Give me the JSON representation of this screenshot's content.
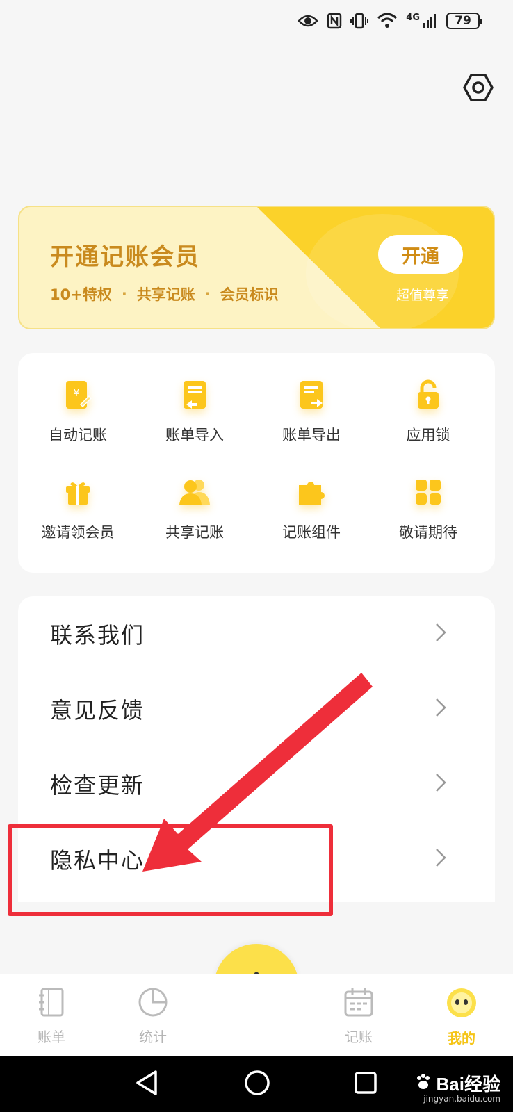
{
  "status_bar": {
    "battery": "79",
    "network": "4G"
  },
  "vip": {
    "title": "开通记账会员",
    "perks": [
      "10+特权",
      "共享记账",
      "会员标识"
    ],
    "separator": "·",
    "open_label": "开通",
    "sub_label": "超值尊享"
  },
  "tools": [
    {
      "label": "自动记账",
      "icon": "auto-bill-icon"
    },
    {
      "label": "账单导入",
      "icon": "import-icon"
    },
    {
      "label": "账单导出",
      "icon": "export-icon"
    },
    {
      "label": "应用锁",
      "icon": "lock-icon"
    },
    {
      "label": "邀请领会员",
      "icon": "gift-icon"
    },
    {
      "label": "共享记账",
      "icon": "users-icon"
    },
    {
      "label": "记账组件",
      "icon": "puzzle-icon"
    },
    {
      "label": "敬请期待",
      "icon": "grid-icon"
    }
  ],
  "menu": [
    {
      "label": "联系我们"
    },
    {
      "label": "意见反馈"
    },
    {
      "label": "检查更新"
    },
    {
      "label": "隐私中心"
    }
  ],
  "tabbar": {
    "bills": "账单",
    "stats": "统计",
    "record": "记账",
    "mine": "我的"
  },
  "watermark": {
    "text": "Bai经验",
    "sub": "jingyan.baidu.com"
  },
  "colors": {
    "accent": "#fbd22a",
    "highlight": "#ee2e3a",
    "vip_text": "#c98a1e"
  }
}
